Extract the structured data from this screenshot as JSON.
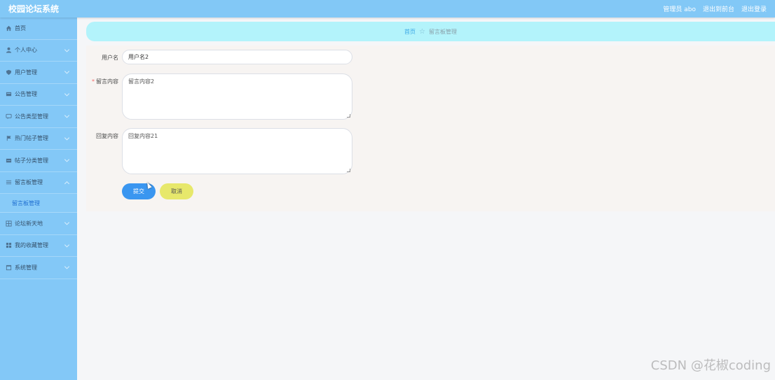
{
  "header": {
    "app_title": "校园论坛系统",
    "user_label": "管理员 abo",
    "front_link": "退出到前台",
    "logout_link": "退出登录"
  },
  "sidebar": {
    "items": [
      {
        "label": "首页",
        "icon": "home-icon"
      },
      {
        "label": "个人中心",
        "icon": "user-icon"
      },
      {
        "label": "用户管理",
        "icon": "shield-icon"
      },
      {
        "label": "公告管理",
        "icon": "notice-icon"
      },
      {
        "label": "公告类型管理",
        "icon": "chat-icon"
      },
      {
        "label": "热门帖子管理",
        "icon": "flag-icon"
      },
      {
        "label": "帖子分类管理",
        "icon": "list-icon"
      },
      {
        "label": "留言板管理",
        "icon": "menu-icon"
      },
      {
        "label": "论坛新天地",
        "icon": "grid-icon"
      },
      {
        "label": "我的收藏管理",
        "icon": "apps-icon"
      },
      {
        "label": "系统管理",
        "icon": "window-icon"
      }
    ],
    "sub_item": "留言板管理"
  },
  "breadcrumb": {
    "home": "首页",
    "current": "留言板管理"
  },
  "form": {
    "username_label": "用户名",
    "username_value": "用户名2",
    "content_label": "留言内容",
    "content_value": "留言内容2",
    "reply_label": "回复内容",
    "reply_value": "回复内容21",
    "submit_label": "提交",
    "cancel_label": "取消"
  },
  "watermark": "CSDN @花椒coding",
  "colors": {
    "header": "#82c8f6",
    "sidebar": "#83c8f7",
    "breadcrumb": "#b3f3fb",
    "submit": "#3a96f0",
    "cancel": "#e7e86b"
  }
}
